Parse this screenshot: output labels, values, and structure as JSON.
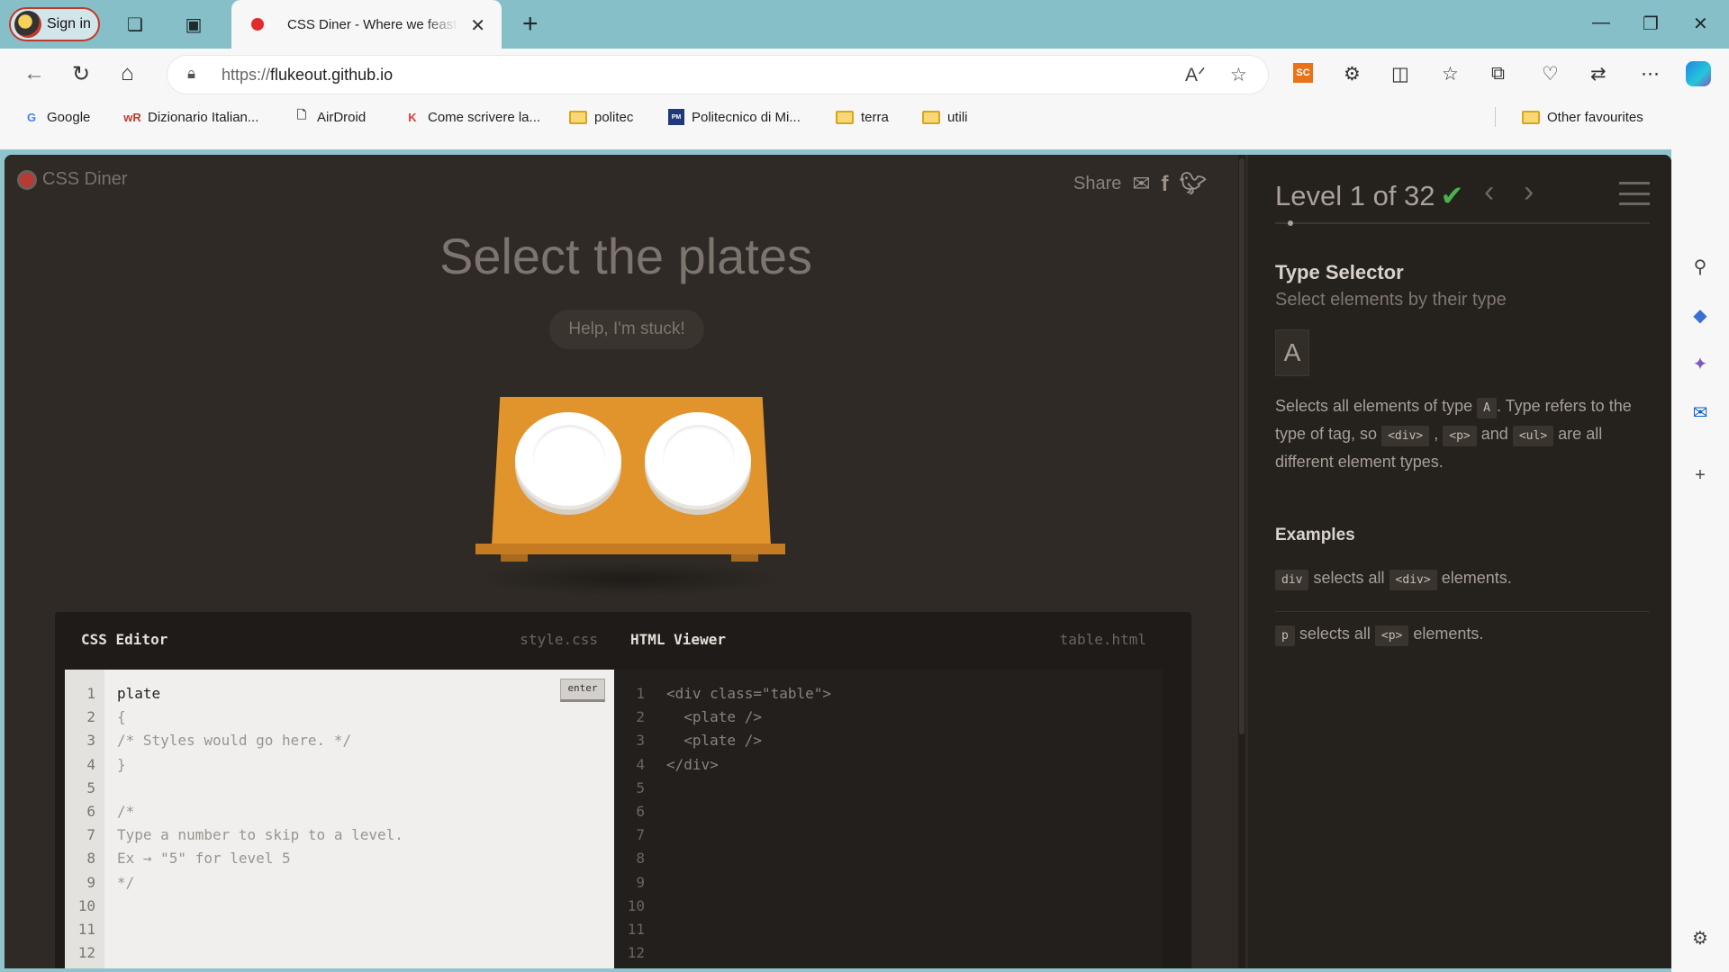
{
  "browser": {
    "signin_label": "Sign in",
    "tab_title": "CSS Diner - Where we feast",
    "url_scheme": "https://",
    "url_host": "flukeout.github.io",
    "sc_badge": "SC",
    "bookmarks": [
      {
        "label": "Google",
        "icon": "google-icon"
      },
      {
        "label": "Dizionario Italian...",
        "icon": "wordreference-icon"
      },
      {
        "label": "AirDroid",
        "icon": "page-icon"
      },
      {
        "label": "Come scrivere la...",
        "icon": "red-k-icon"
      },
      {
        "label": "politec",
        "icon": "folder-icon"
      },
      {
        "label": "Politecnico di Mi...",
        "icon": "polimi-icon"
      },
      {
        "label": "terra",
        "icon": "folder-icon"
      },
      {
        "label": "utili",
        "icon": "folder-icon"
      }
    ],
    "other_favourites": "Other favourites",
    "colors": {
      "titlebar": "#87bfc8",
      "accent": "#c0392b"
    }
  },
  "game": {
    "logo": "CSS Diner",
    "share_label": "Share",
    "instruction": "Select the plates",
    "help_button": "Help, I'm stuck!",
    "css_editor": {
      "title": "CSS Editor",
      "file": "style.css",
      "enter_label": "enter",
      "line_numbers": "1\n2\n3\n4\n5\n6\n7\n8\n9\n10\n11\n12",
      "input_value": "plate",
      "code": "\n{\n/* Styles would go here. */\n}\n\n/*\nType a number to skip to a level.\nEx → \"5\" for level 5\n*/"
    },
    "html_viewer": {
      "title": "HTML Viewer",
      "file": "table.html",
      "line_numbers": "1\n2\n3\n4\n5\n6\n7\n8\n9\n10\n11\n12",
      "code": "<div class=\"table\">\n  <plate />\n  <plate />\n</div>"
    }
  },
  "level_panel": {
    "level_text": "Level 1 of 32",
    "check": "✔",
    "selector_name": "Type Selector",
    "selector_desc": "Select elements by their type",
    "syntax": "A",
    "hint": {
      "t1": "Selects all elements of type",
      "tag_a": "A",
      "t2": ". Type refers to the type of tag, so",
      "tag_div": "<div>",
      "sep1": ",",
      "tag_p": "<p>",
      "t3": "and",
      "tag_ul": "<ul>",
      "t4": "are all different element types."
    },
    "examples_title": "Examples",
    "examples": [
      {
        "code": "div",
        "text": "selects all",
        "tag": "<div>",
        "end": "elements."
      },
      {
        "code": "p",
        "text": "selects all",
        "tag": "<p>",
        "end": "elements."
      }
    ]
  }
}
